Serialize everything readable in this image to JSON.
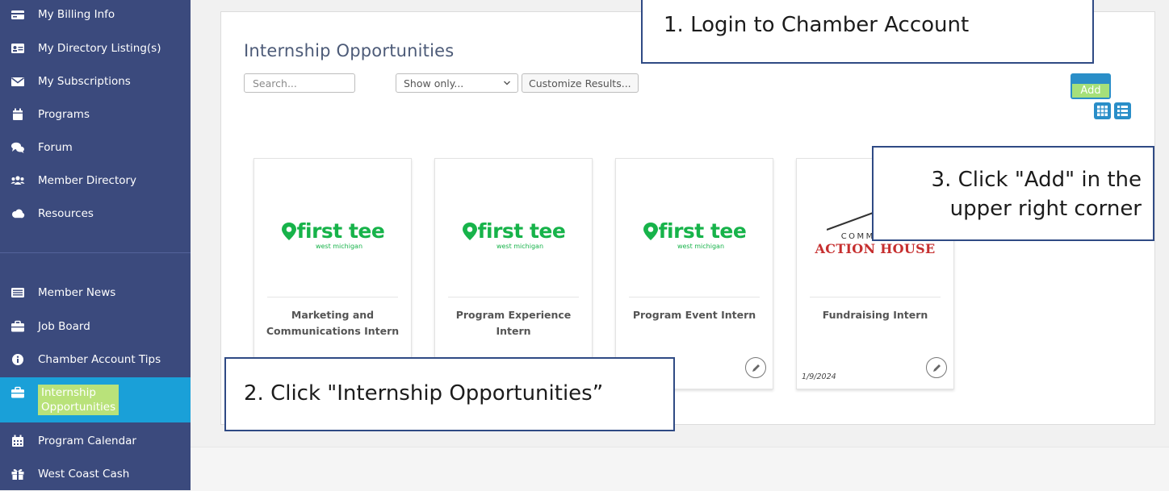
{
  "sidebar": {
    "items": [
      {
        "label": "My Billing Info",
        "icon": "credit-card-icon"
      },
      {
        "label": "My Directory Listing(s)",
        "icon": "id-card-icon"
      },
      {
        "label": "My Subscriptions",
        "icon": "envelope-icon"
      },
      {
        "label": "Programs",
        "icon": "calendar-icon"
      },
      {
        "label": "Forum",
        "icon": "comments-icon"
      },
      {
        "label": "Member Directory",
        "icon": "users-icon"
      },
      {
        "label": "Resources",
        "icon": "cloud-icon"
      },
      {
        "label": "Member News",
        "icon": "newspaper-icon"
      },
      {
        "label": "Job Board",
        "icon": "briefcase-icon"
      },
      {
        "label": "Chamber Account Tips",
        "icon": "info-circle-icon"
      },
      {
        "label": "Internship Opportunities",
        "label_line1": "Internship",
        "label_line2": "Opportunities",
        "icon": "briefcase-icon",
        "active": true
      },
      {
        "label": "Program Calendar",
        "icon": "calendar-grid-icon"
      },
      {
        "label": "West Coast Cash",
        "icon": "gift-icon"
      }
    ]
  },
  "main": {
    "title": "Internship Opportunities",
    "search": {
      "placeholder": "Search...",
      "value": ""
    },
    "filter": {
      "selected": "Show only..."
    },
    "customize_label": "Customize Results...",
    "add_label": "Add",
    "view_buttons": [
      "grid-view-icon",
      "list-view-icon"
    ]
  },
  "cards": [
    {
      "logo": "first tee",
      "logo_sub": "west michigan",
      "title_line1": "Marketing and",
      "title_line2": "Communications Intern",
      "date": ""
    },
    {
      "logo": "first tee",
      "logo_sub": "west michigan",
      "title_line1": "Program Experience",
      "title_line2": "Intern",
      "date": ""
    },
    {
      "logo": "first tee",
      "logo_sub": "west michigan",
      "title_line1": "Program Event Intern",
      "title_line2": "",
      "date": ""
    },
    {
      "logo_top": "COMMUNITY",
      "logo_bottom": "ACTION HOUSE",
      "title_line1": "Fundraising Intern",
      "title_line2": "",
      "date": "1/9/2024"
    }
  ],
  "callouts": {
    "step1": "1. Login to Chamber Account",
    "step2": "2. Click \"Internship Opportunities”",
    "step3_line1": "3. Click \"Add\" in the",
    "step3_line2": "upper right corner"
  },
  "colors": {
    "sidebar_bg": "#3b4a7d",
    "active_bg": "#1aa0d8",
    "highlight": "#b9e27a",
    "accent_button": "#2a8ec8",
    "first_tee_green": "#17b34a",
    "cah_red": "#c62f2f",
    "callout_border": "#2f4a84"
  }
}
